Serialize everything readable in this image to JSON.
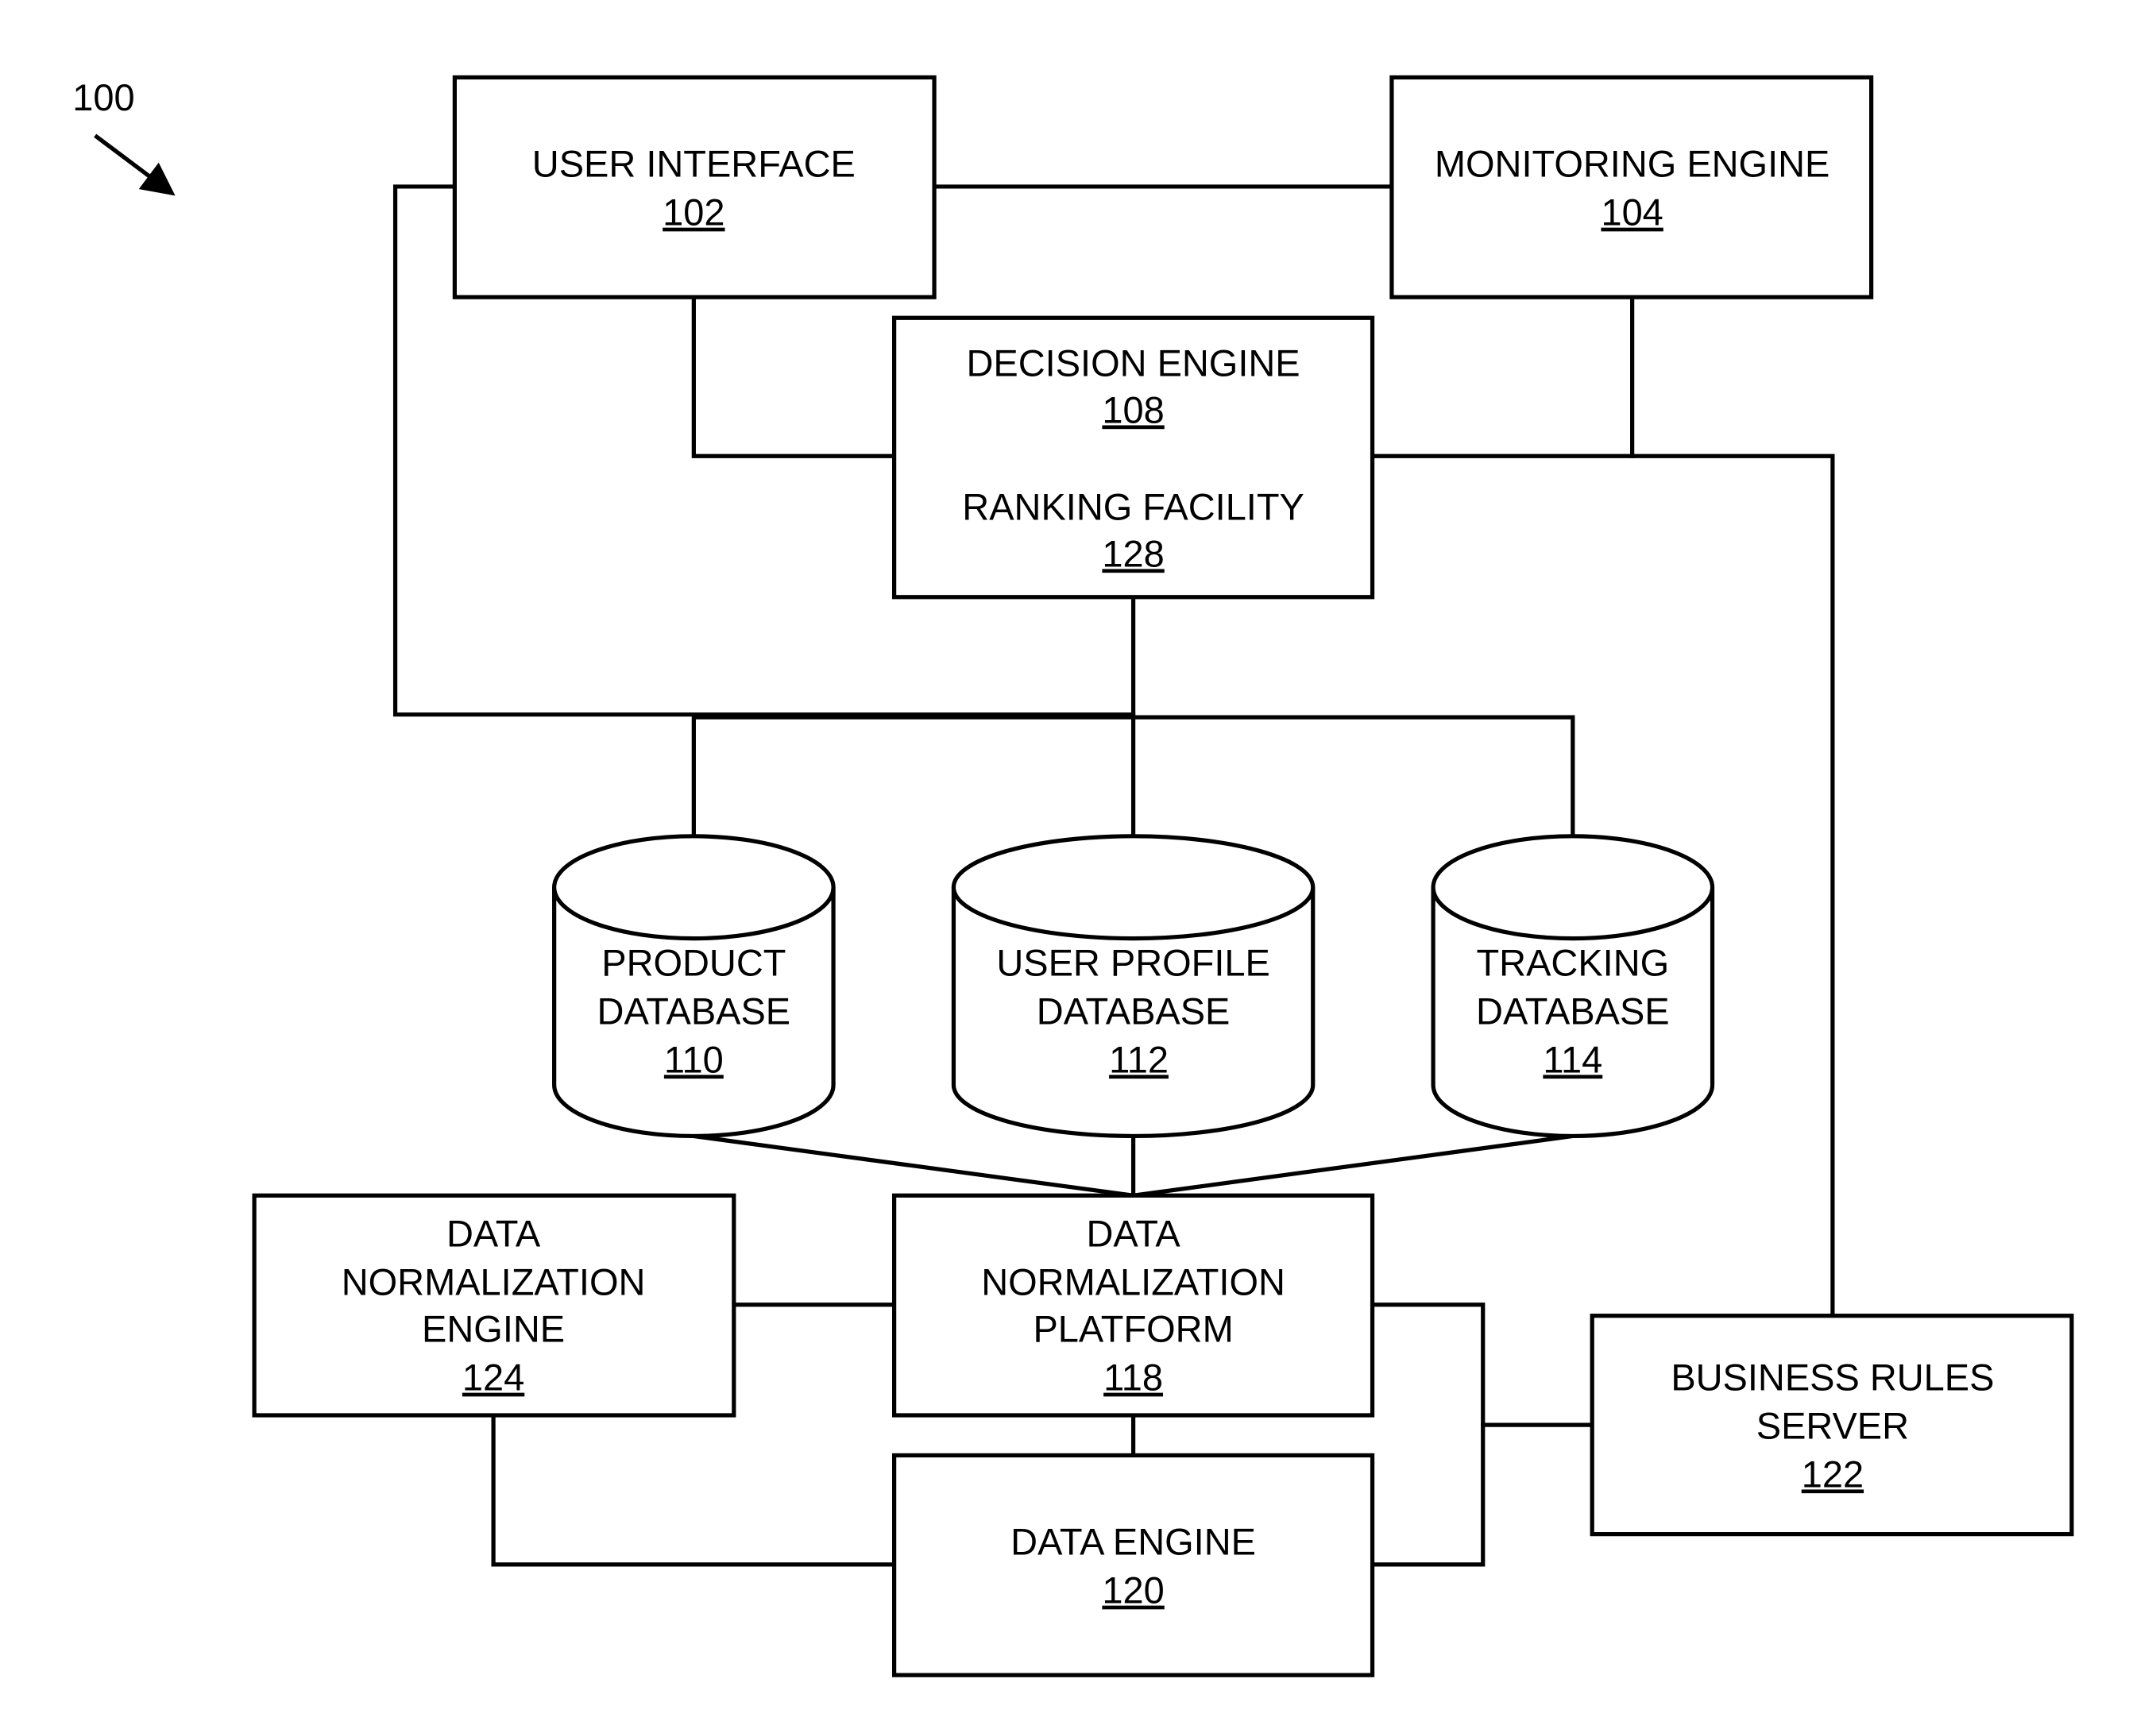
{
  "figure": {
    "reference_label": "100",
    "colors": {
      "line": "#000000",
      "background": "#ffffff"
    }
  },
  "nodes": {
    "user_interface": {
      "lines": [
        "USER INTERFACE"
      ],
      "ref": "102",
      "shape": "box"
    },
    "monitoring_engine": {
      "lines": [
        "MONITORING ENGINE"
      ],
      "ref": "104",
      "shape": "box"
    },
    "decision_engine": {
      "lines": [
        "DECISION ENGINE"
      ],
      "ref": "108",
      "shape": "box"
    },
    "ranking_facility": {
      "lines": [
        "RANKING FACILITY"
      ],
      "ref": "128",
      "shape": "box-section"
    },
    "product_database": {
      "lines": [
        "PRODUCT",
        "DATABASE"
      ],
      "ref": "110",
      "shape": "cylinder"
    },
    "user_profile_database": {
      "lines": [
        "USER PROFILE",
        "DATABASE"
      ],
      "ref": "112",
      "shape": "cylinder"
    },
    "tracking_database": {
      "lines": [
        "TRACKING",
        "DATABASE"
      ],
      "ref": "114",
      "shape": "cylinder"
    },
    "data_normalization_engine": {
      "lines": [
        "DATA",
        "NORMALIZATION",
        "ENGINE"
      ],
      "ref": "124",
      "shape": "box"
    },
    "data_normalization_platform": {
      "lines": [
        "DATA",
        "NORMALIZATION",
        "PLATFORM"
      ],
      "ref": "118",
      "shape": "box"
    },
    "data_engine": {
      "lines": [
        "DATA ENGINE"
      ],
      "ref": "120",
      "shape": "box"
    },
    "business_rules_server": {
      "lines": [
        "BUSINESS RULES",
        "SERVER"
      ],
      "ref": "122",
      "shape": "box"
    }
  },
  "edges": [
    [
      "user_interface",
      "monitoring_engine"
    ],
    [
      "user_interface",
      "decision_engine"
    ],
    [
      "monitoring_engine",
      "decision_engine"
    ],
    [
      "monitoring_engine",
      "business_rules_server"
    ],
    [
      "user_interface",
      "product_database"
    ],
    [
      "decision_engine",
      "product_database"
    ],
    [
      "decision_engine",
      "user_profile_database"
    ],
    [
      "decision_engine",
      "tracking_database"
    ],
    [
      "product_database",
      "data_normalization_platform"
    ],
    [
      "user_profile_database",
      "data_normalization_platform"
    ],
    [
      "tracking_database",
      "data_normalization_platform"
    ],
    [
      "data_normalization_engine",
      "data_normalization_platform"
    ],
    [
      "data_normalization_platform",
      "data_engine"
    ],
    [
      "data_normalization_engine",
      "data_engine"
    ],
    [
      "data_normalization_platform",
      "business_rules_server"
    ],
    [
      "data_engine",
      "business_rules_server"
    ]
  ]
}
